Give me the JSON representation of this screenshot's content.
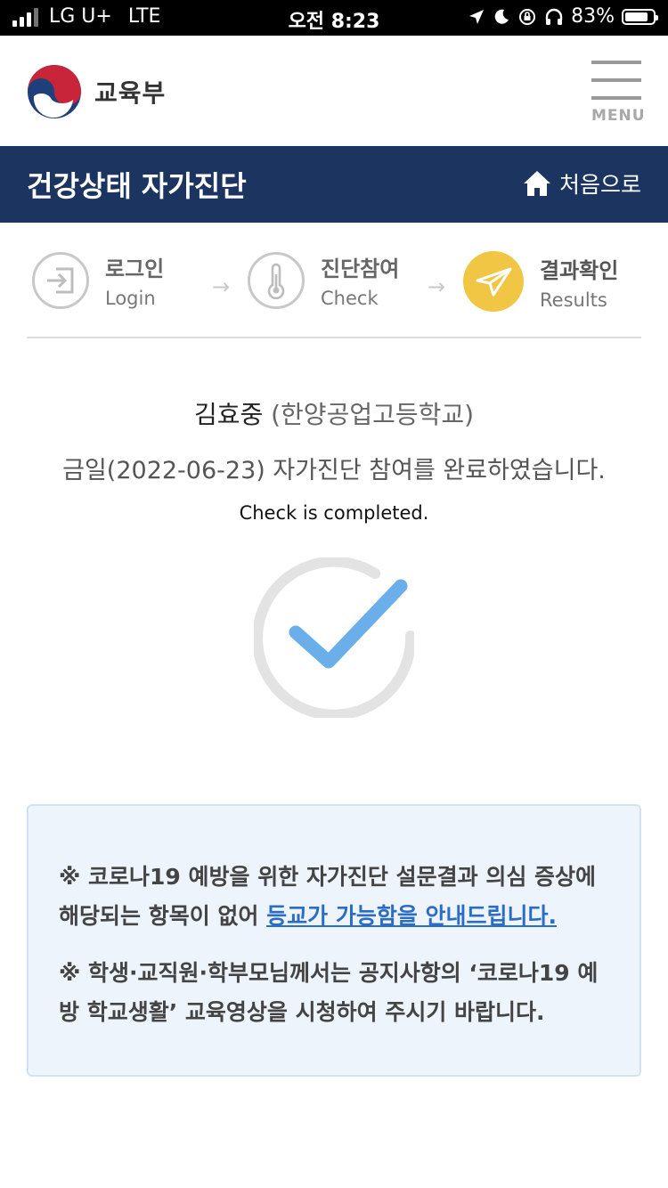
{
  "status_bar": {
    "carrier": "LG U+",
    "network": "LTE",
    "time": "오전 8:23",
    "battery": "83%",
    "battery_level": 0.83
  },
  "header": {
    "logo_text": "교육부",
    "menu_label": "MENU"
  },
  "title_bar": {
    "title": "건강상태 자가진단",
    "home_label": "처음으로"
  },
  "steps": [
    {
      "ko": "로그인",
      "en": "Login",
      "icon": "login-icon"
    },
    {
      "ko": "진단참여",
      "en": "Check",
      "icon": "thermometer-icon"
    },
    {
      "ko": "결과확인",
      "en": "Results",
      "icon": "send-icon"
    }
  ],
  "step_arrow": "→",
  "result": {
    "name": "김효중",
    "school": "(한양공업고등학교)",
    "completed_ko": "금일(2022-06-23) 자가진단 참여를 완료하였습니다.",
    "completed_en": "Check is completed."
  },
  "notice": {
    "line1_prefix": "※ 코로나19 예방을 위한 자가진단 설문결과 의심 증상에 해당되는 항목이 없어 ",
    "line1_link": "등교가 가능함을 안내드립니다.",
    "line2": "※ 학생·교직원·학부모님께서는 공지사항의 ‘코로나19 예방 학교생활’ 교육영상을 시청하여 주시기 바랍니다."
  },
  "colors": {
    "title_bar_bg": "#1b3560",
    "active_step": "#f1c644",
    "check_mark": "#6aaeea",
    "link": "#2b6cc4",
    "notice_bg": "#eef4fb"
  }
}
